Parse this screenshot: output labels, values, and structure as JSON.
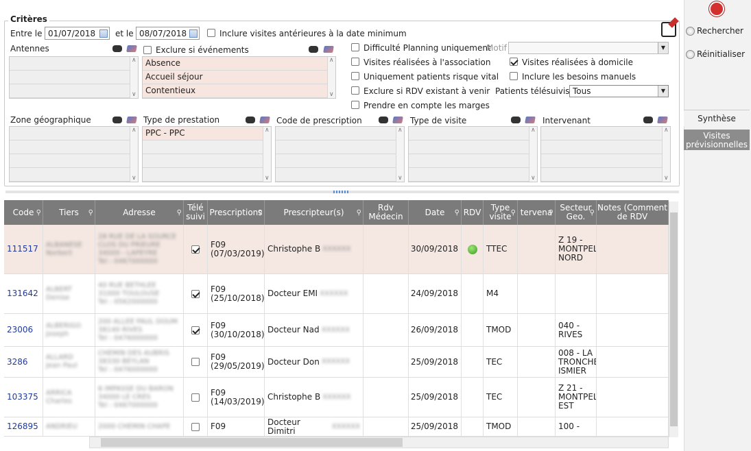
{
  "criteria": {
    "legend": "Critères",
    "between_label": "Entre le",
    "date_from": "01/07/2018",
    "and_label": "et le",
    "date_to": "08/07/2018",
    "include_prev_label": "Inclure visites antérieures à la date minimum",
    "antennes_label": "Antennes",
    "exclude_events_label": "Exclure si événements",
    "events": [
      "Absence",
      "Accueil séjour",
      "Contentieux"
    ],
    "difficulty_label": "Difficulté Planning uniquement",
    "motif_label": "Motif",
    "visits_assoc_label": "Visites réalisées à l'association",
    "visits_home_label": "Visites réalisées à domicile",
    "vital_risk_label": "Uniquement patients risque vital",
    "manual_needs_label": "Inclure les besoins manuels",
    "exclude_rdv_label": "Exclure si RDV existant à venir",
    "telesuivi_label": "Patients télésuivis",
    "telesuivi_value": "Tous",
    "margins_label": "Prendre en compte les marges",
    "zone_label": "Zone géographique",
    "prestation_label": "Type de prestation",
    "prestation_items": [
      "PPC - PPC"
    ],
    "prescription_code_label": "Code de prescription",
    "visit_type_label": "Type de visite",
    "intervenant_label": "Intervenant"
  },
  "sidebar": {
    "search_label": "Rechercher",
    "reset_label": "Réinitialiser",
    "tab_synthese": "Synthèse",
    "tab_previsions": "Visites prévisionnelles"
  },
  "table": {
    "headers": [
      "Code",
      "Tiers",
      "Adresse",
      "Télé suivi",
      "Prescriptions",
      "Prescripteur(s)",
      "Rdv Médecin",
      "Date",
      "RDV",
      "Type visite",
      "tervena",
      "Secteur Geo.",
      "Notes (Comment de RDV"
    ],
    "rows": [
      {
        "code": "111517",
        "presc": "F09 (07/03/2019)",
        "prescriber": "Christophe B",
        "date": "30/09/2018",
        "type": "TTEC",
        "sector": "Z 19 - MONTPEL NORD"
      },
      {
        "code": "131642",
        "presc": "F09 (25/10/2018)",
        "prescriber": "Docteur EMI",
        "date": "24/09/2018",
        "type": "M4",
        "sector": ""
      },
      {
        "code": "23006",
        "presc": "F09 (30/10/2018)",
        "prescriber": "Docteur Nad",
        "date": "26/09/2018",
        "type": "TMOD",
        "sector": "040 - RIVES"
      },
      {
        "code": "3286",
        "presc": "F09 (29/05/2019)",
        "prescriber": "Docteur Don",
        "date": "25/09/2018",
        "type": "TEC",
        "sector": "008 - LA TRONCHE ISMIER"
      },
      {
        "code": "103375",
        "presc": "F09 (14/03/2019)",
        "prescriber": "Christophe B",
        "date": "25/09/2018",
        "type": "TEC",
        "sector": "Z 21 - MONTPEL EST"
      },
      {
        "code": "126895",
        "presc": "F09",
        "prescriber": "Docteur Dimitri",
        "date": "25/09/2018",
        "type": "TMOD",
        "sector": "100 -"
      }
    ]
  },
  "colors": {
    "header_bg": "#7b7b7b",
    "selected_row": "#f5e8e2",
    "link": "#1f3a9c"
  }
}
